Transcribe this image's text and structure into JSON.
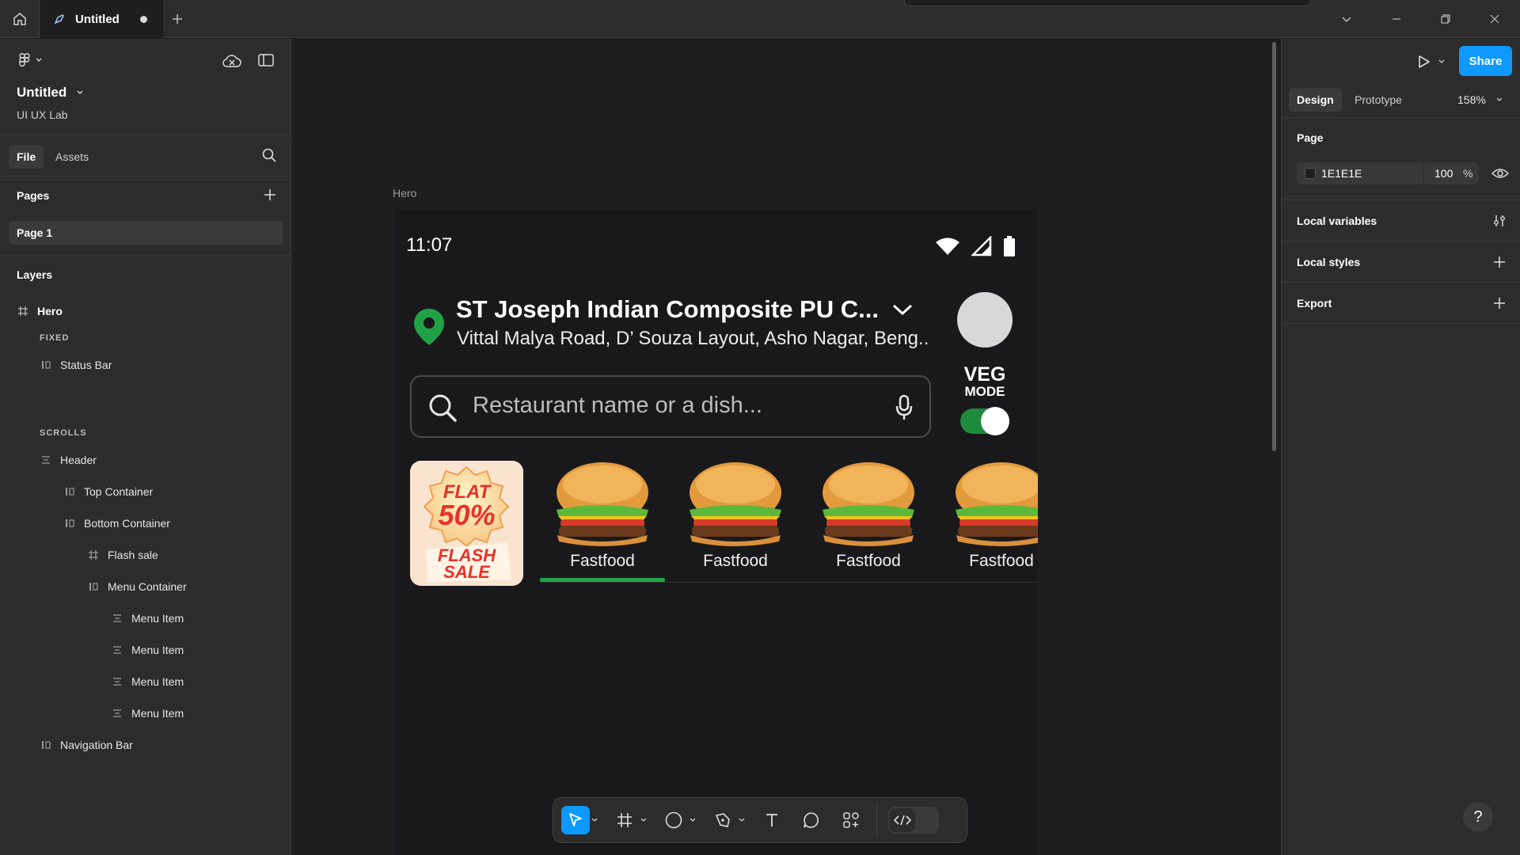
{
  "titlebar": {
    "tab_title": "Untitled",
    "icons": [
      "home-icon",
      "figma-file-icon",
      "unsaved-dot",
      "plus-icon",
      "chevron-down-icon",
      "minimize-icon",
      "restore-icon",
      "close-icon"
    ]
  },
  "left_panel": {
    "file_name": "Untitled",
    "team_name": "UI UX Lab",
    "tabs": [
      "File",
      "Assets"
    ],
    "pages_heading": "Pages",
    "pages": [
      "Page 1"
    ],
    "layers_heading": "Layers",
    "layers": {
      "hero": "Hero",
      "fixed_label": "FIXED",
      "status_bar": "Status Bar",
      "scrolls_label": "SCROLLS",
      "header": "Header",
      "top_container": "Top Container",
      "bottom_container": "Bottom Container",
      "flash_sale": "Flash sale",
      "menu_container": "Menu Container",
      "menu_items": [
        "Menu Item",
        "Menu Item",
        "Menu Item",
        "Menu Item"
      ],
      "navigation_bar": "Navigation Bar"
    }
  },
  "canvas": {
    "frame_label": "Hero",
    "phone": {
      "time": "11:07",
      "location_title": "ST Joseph Indian Composite PU C...",
      "location_subtitle": "Vittal Malya Road, D’ Souza Layout, Asho Nagar, Beng..",
      "search_placeholder": "Restaurant name or a dish...",
      "veg_line1": "VEG",
      "veg_line2": "MODE",
      "veg_mode_on": true,
      "flash_sale": {
        "line1": "FLAT",
        "line2": "50%",
        "line3": "FLASH",
        "line4": "SALE"
      },
      "menu_items": [
        "Fastfood",
        "Fastfood",
        "Fastfood",
        "Fastfood"
      ],
      "accent_green": "#21a146"
    },
    "toolbar": [
      "move-tool",
      "frame-tool",
      "shape-tool",
      "pen-tool",
      "text-tool",
      "comment-tool",
      "actions-tool",
      "dev-mode-toggle"
    ]
  },
  "right_panel": {
    "share_label": "Share",
    "tabs": [
      "Design",
      "Prototype"
    ],
    "zoom": "158%",
    "page_heading": "Page",
    "page_color": "1E1E1E",
    "page_opacity": "100",
    "percent_sign": "%",
    "local_variables": "Local variables",
    "local_styles": "Local styles",
    "export": "Export",
    "help": "?",
    "accent_blue": "#0d99ff"
  }
}
